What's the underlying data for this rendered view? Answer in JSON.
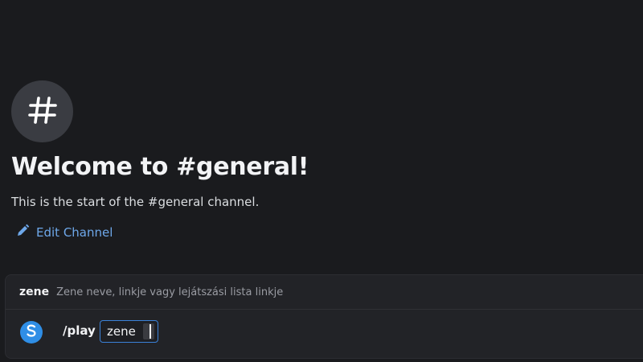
{
  "welcome": {
    "icon": "hash-icon",
    "title": "Welcome to #general!",
    "subtitle": "This is the start of the #general channel.",
    "edit_channel_label": "Edit Channel",
    "edit_icon": "pencil-icon"
  },
  "command_panel": {
    "option_name": "zene",
    "option_description": "Zene neve, linkje vagy lejátszási lista linkje",
    "bot_avatar_icon": "bot-s-icon",
    "command": "/play",
    "option_pill_value": "zene"
  },
  "colors": {
    "background": "#1a1b1e",
    "link": "#6ea8ea",
    "accent": "#3b82d9",
    "bot_avatar": "#2f8ee6"
  }
}
